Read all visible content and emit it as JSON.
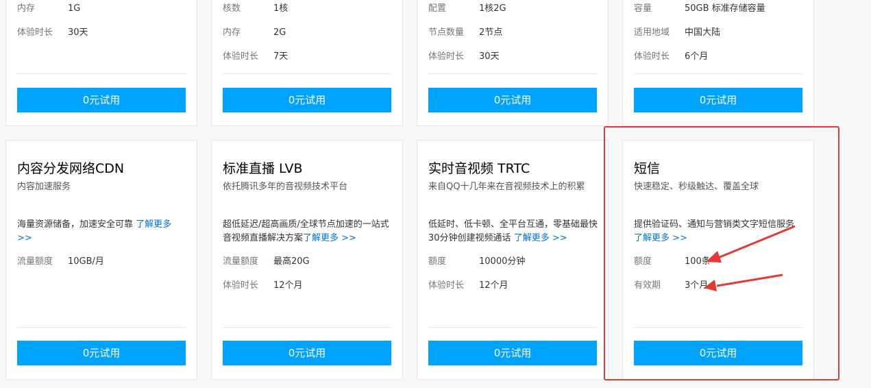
{
  "top_cards": [
    {
      "rows": [
        {
          "k": "内存",
          "v": "1G"
        },
        {
          "k": "体验时长",
          "v": "30天"
        }
      ],
      "button": "0元试用"
    },
    {
      "rows": [
        {
          "k": "核数",
          "v": "1核"
        },
        {
          "k": "内存",
          "v": "2G"
        },
        {
          "k": "体验时长",
          "v": "7天"
        }
      ],
      "button": "0元试用"
    },
    {
      "rows": [
        {
          "k": "配置",
          "v": "1核2G"
        },
        {
          "k": "节点数量",
          "v": "2节点"
        },
        {
          "k": "体验时长",
          "v": "30天"
        }
      ],
      "button": "0元试用"
    },
    {
      "rows": [
        {
          "k": "容量",
          "v": "50GB 标准存储容量"
        },
        {
          "k": "适用地域",
          "v": "中国大陆"
        },
        {
          "k": "体验时长",
          "v": "6个月"
        }
      ],
      "button": "0元试用"
    }
  ],
  "bottom_cards": [
    {
      "title": "内容分发网络CDN",
      "subtitle": "内容加速服务",
      "desc": "海量资源储备，加速安全可靠",
      "link": "了解更多 >>",
      "rows": [
        {
          "k": "流量额度",
          "v": "10GB/月"
        }
      ],
      "button": "0元试用"
    },
    {
      "title": "标准直播 LVB",
      "subtitle": "依托腾讯多年的音视频技术平台",
      "desc": "超低延迟/超高画质/全球节点加速的一站式音视频直播解决方案",
      "link": "了解更多 >>",
      "rows": [
        {
          "k": "流量额度",
          "v": "最高20G"
        },
        {
          "k": "体验时长",
          "v": "12个月"
        }
      ],
      "button": "0元试用"
    },
    {
      "title": "实时音视频 TRTC",
      "subtitle": "来自QQ十几年来在音视频技术上的积累",
      "desc": "低延时、低卡顿、全平台互通，零基础最快30分钟创建视频通话",
      "link": "了解更多 >>",
      "rows": [
        {
          "k": "额度",
          "v": "10000分钟"
        },
        {
          "k": "体验时长",
          "v": "12个月"
        }
      ],
      "button": "0元试用"
    },
    {
      "title": "短信",
      "subtitle": "快速稳定、秒级触达、覆盖全球",
      "desc": "提供验证码、通知与营销类文字短信服务",
      "link": "了解更多 >>",
      "rows": [
        {
          "k": "额度",
          "v": "100条"
        },
        {
          "k": "有效期",
          "v": "3个月"
        }
      ],
      "button": "0元试用"
    }
  ],
  "annotation_color": "#e53935",
  "accent_color": "#00a4ff",
  "link_color": "#0073d6"
}
